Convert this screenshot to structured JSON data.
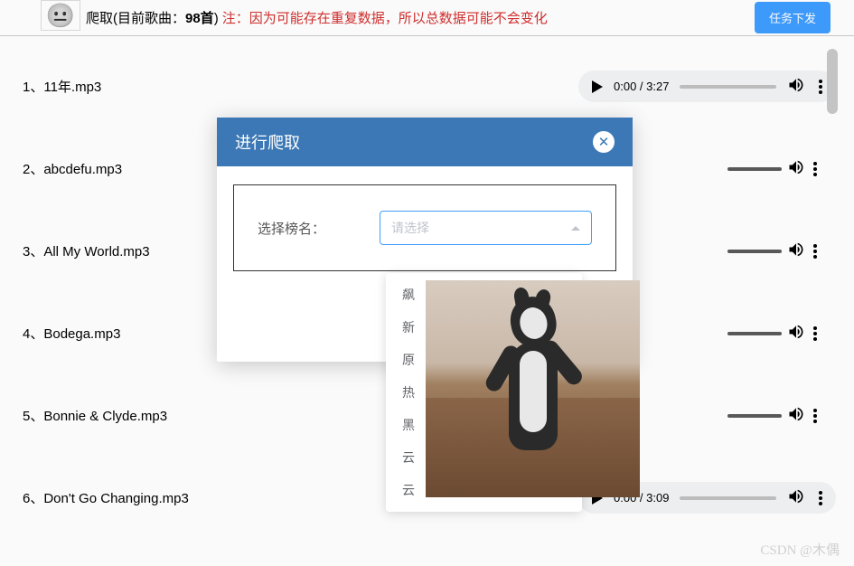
{
  "header": {
    "title_prefix": "爬取(目前歌曲：",
    "song_count": "98首",
    "title_suffix": ")",
    "warning": "注：因为可能存在重复数据，所以总数据可能不会变化",
    "task_button": "任务下发"
  },
  "songs": [
    {
      "index": "1、",
      "name": "11年.mp3",
      "time": "0:00 / 3:27",
      "full": true
    },
    {
      "index": "2、",
      "name": "abcdefu.mp3",
      "full": false
    },
    {
      "index": "3、",
      "name": "All My World.mp3",
      "full": false
    },
    {
      "index": "4、",
      "name": "Bodega.mp3",
      "full": false
    },
    {
      "index": "5、",
      "name": "Bonnie & Clyde.mp3",
      "full": false
    },
    {
      "index": "6、",
      "name": "Don't Go Changing.mp3",
      "time": "0:00 / 3:09",
      "full": true
    }
  ],
  "modal": {
    "title": "进行爬取",
    "form_label": "选择榜名：",
    "select_placeholder": "请选择"
  },
  "dropdown_options": [
    "飙",
    "新",
    "原",
    "热",
    "黑",
    "云",
    "云"
  ],
  "watermark": "CSDN @木偶"
}
